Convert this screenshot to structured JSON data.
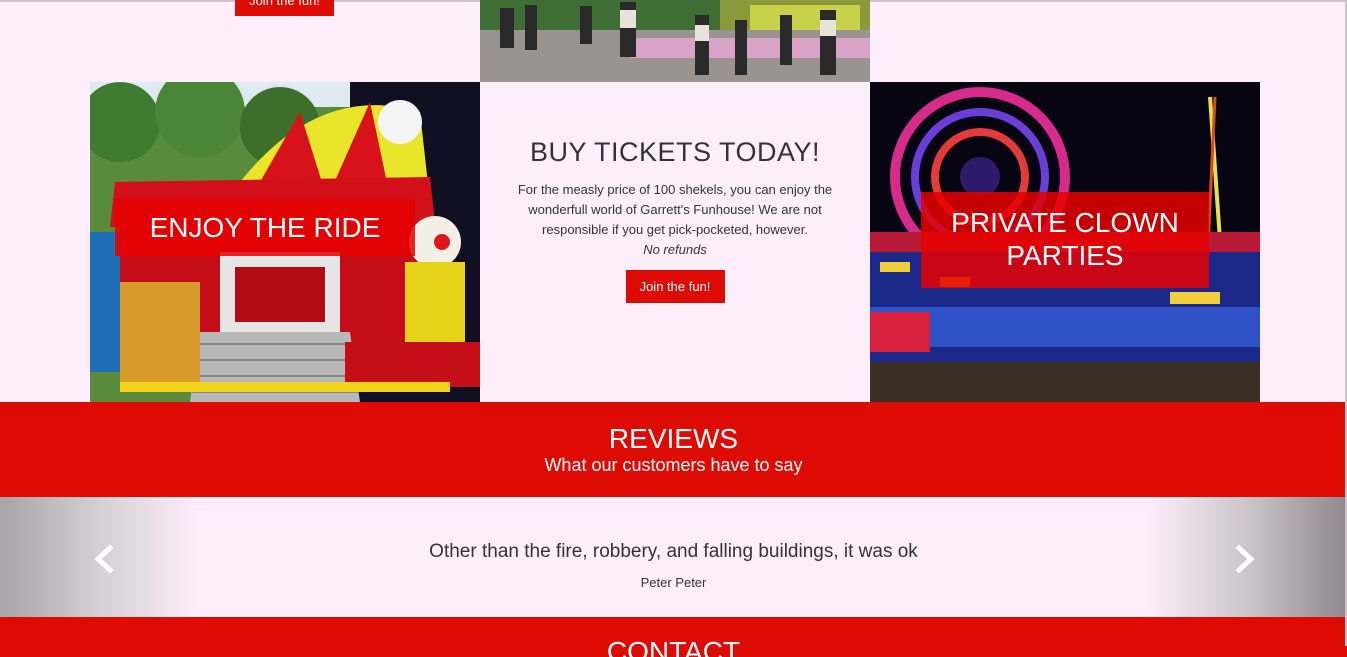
{
  "top": {
    "button_label": "Join the fun!"
  },
  "features": {
    "left_caption": "ENJOY THE RIDE",
    "right_caption_line1": "PRIVATE CLOWN",
    "right_caption_line2": "PARTIES",
    "mid": {
      "title": "BUY TICKETS TODAY!",
      "text": "For the measly price of 100 shekels, you can enjoy the wonderfull world of Garrett's Funhouse! We are not responsible if you get pick-pocketed, however.",
      "note": "No refunds",
      "button_label": "Join the fun!"
    }
  },
  "reviews": {
    "title": "REVIEWS",
    "subtitle": "What our customers have to say",
    "quote": "Other than the fire, robbery, and falling buildings, it was ok",
    "author": "Peter Peter"
  },
  "contact": {
    "title": "CONTACT"
  },
  "colors": {
    "accent": "#dd0b04",
    "page_bg": "#fdeefb"
  }
}
